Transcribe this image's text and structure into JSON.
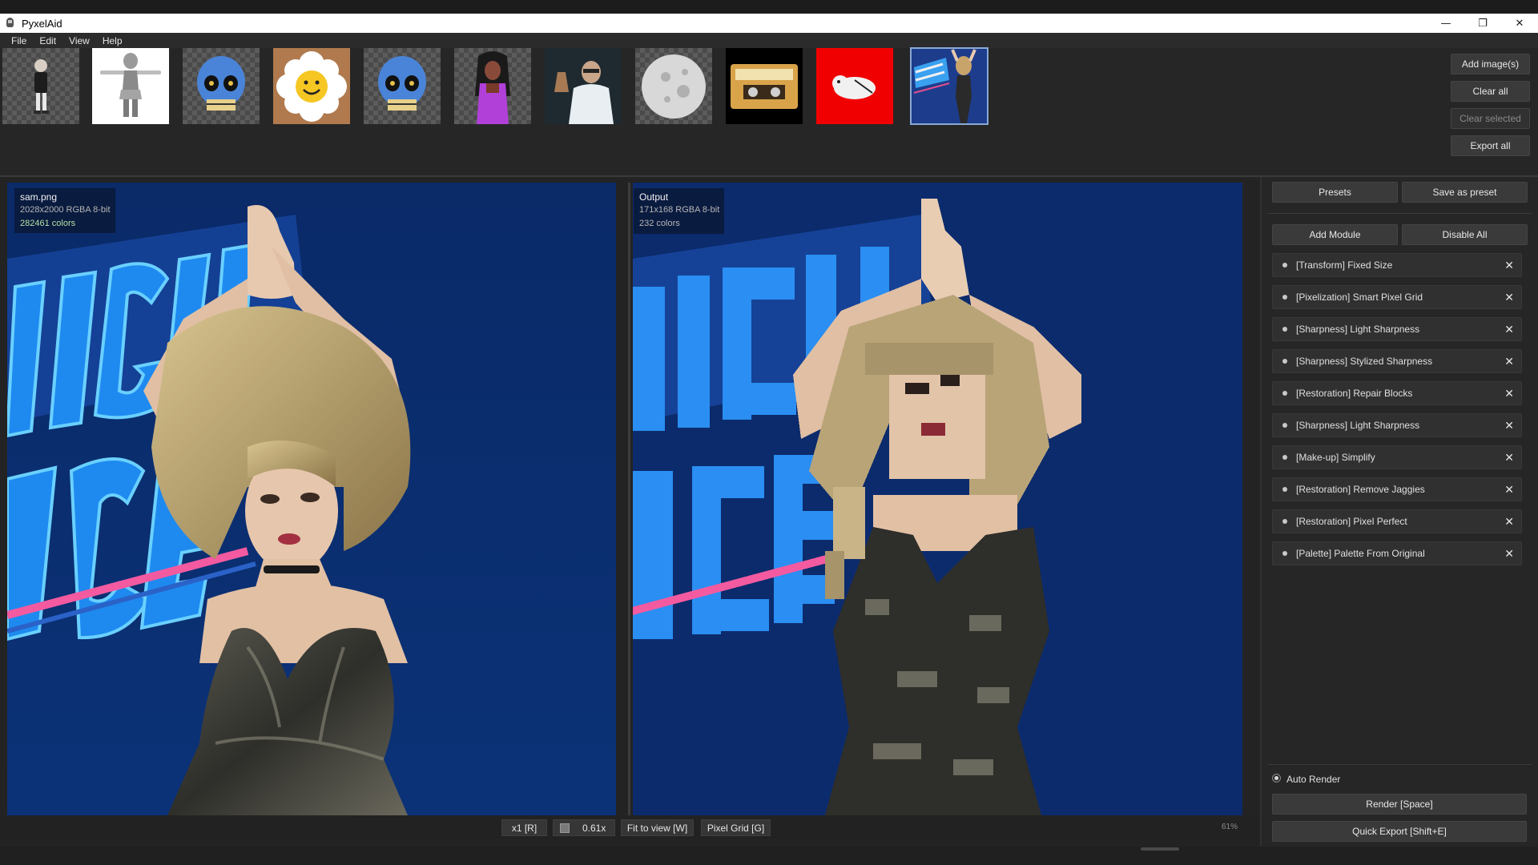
{
  "window": {
    "title": "PyxelAid",
    "minimize_glyph": "—",
    "maximize_glyph": "❐",
    "close_glyph": "✕"
  },
  "menu": [
    "File",
    "Edit",
    "View",
    "Help"
  ],
  "thumbnails": [
    {
      "name": "thumb-figure-small",
      "bg": "checker"
    },
    {
      "name": "thumb-tpose-character",
      "bg": "#ffffff"
    },
    {
      "name": "thumb-skull",
      "bg": "checker"
    },
    {
      "name": "thumb-smiley-flower",
      "bg": "#b07a4e"
    },
    {
      "name": "thumb-skull-2",
      "bg": "checker"
    },
    {
      "name": "thumb-purple-woman",
      "bg": "checker"
    },
    {
      "name": "thumb-scientist",
      "bg": "#1e2a30"
    },
    {
      "name": "thumb-moon-ball",
      "bg": "checker"
    },
    {
      "name": "thumb-mixtape",
      "bg": "#000000"
    },
    {
      "name": "thumb-red-creature",
      "bg": "#f00000"
    },
    {
      "name": "thumb-night-dancers",
      "bg": "#1f3f8f"
    }
  ],
  "side_buttons": {
    "add_images": "Add image(s)",
    "clear_all": "Clear all",
    "clear_selected": "Clear selected",
    "export_all": "Export all"
  },
  "source": {
    "filename": "sam.png",
    "meta": "2028x2000  RGBA  8-bit",
    "colors": "282461 colors"
  },
  "output": {
    "label": "Output",
    "meta": "171x168  RGBA  8-bit",
    "colors": "232 colors"
  },
  "bottom": {
    "x1": "x1 [R]",
    "zoom_value": "0.61x",
    "fit": "Fit to view [W]",
    "pixel_grid": "Pixel Grid [G]",
    "zoom_pct": "61%"
  },
  "panel": {
    "presets": "Presets",
    "save_preset": "Save as preset",
    "add_module": "Add Module",
    "disable_all": "Disable All",
    "modules": [
      "[Transform] Fixed Size",
      "[Pixelization] Smart Pixel Grid",
      "[Sharpness] Light Sharpness",
      "[Sharpness] Stylized Sharpness",
      "[Restoration] Repair Blocks",
      "[Sharpness] Light Sharpness",
      "[Make-up] Simplify",
      "[Restoration] Remove Jaggies",
      "[Restoration] Pixel Perfect",
      "[Palette] Palette From Original"
    ],
    "close_glyph": "✕",
    "auto_render": "Auto Render",
    "render": "Render  [Space]",
    "quick_export": "Quick Export  [Shift+E]"
  },
  "colors": {
    "canvas_bg": "#0d2a66",
    "logo_blue": "#1e7fe0",
    "stripe_pink": "#e0508e"
  }
}
